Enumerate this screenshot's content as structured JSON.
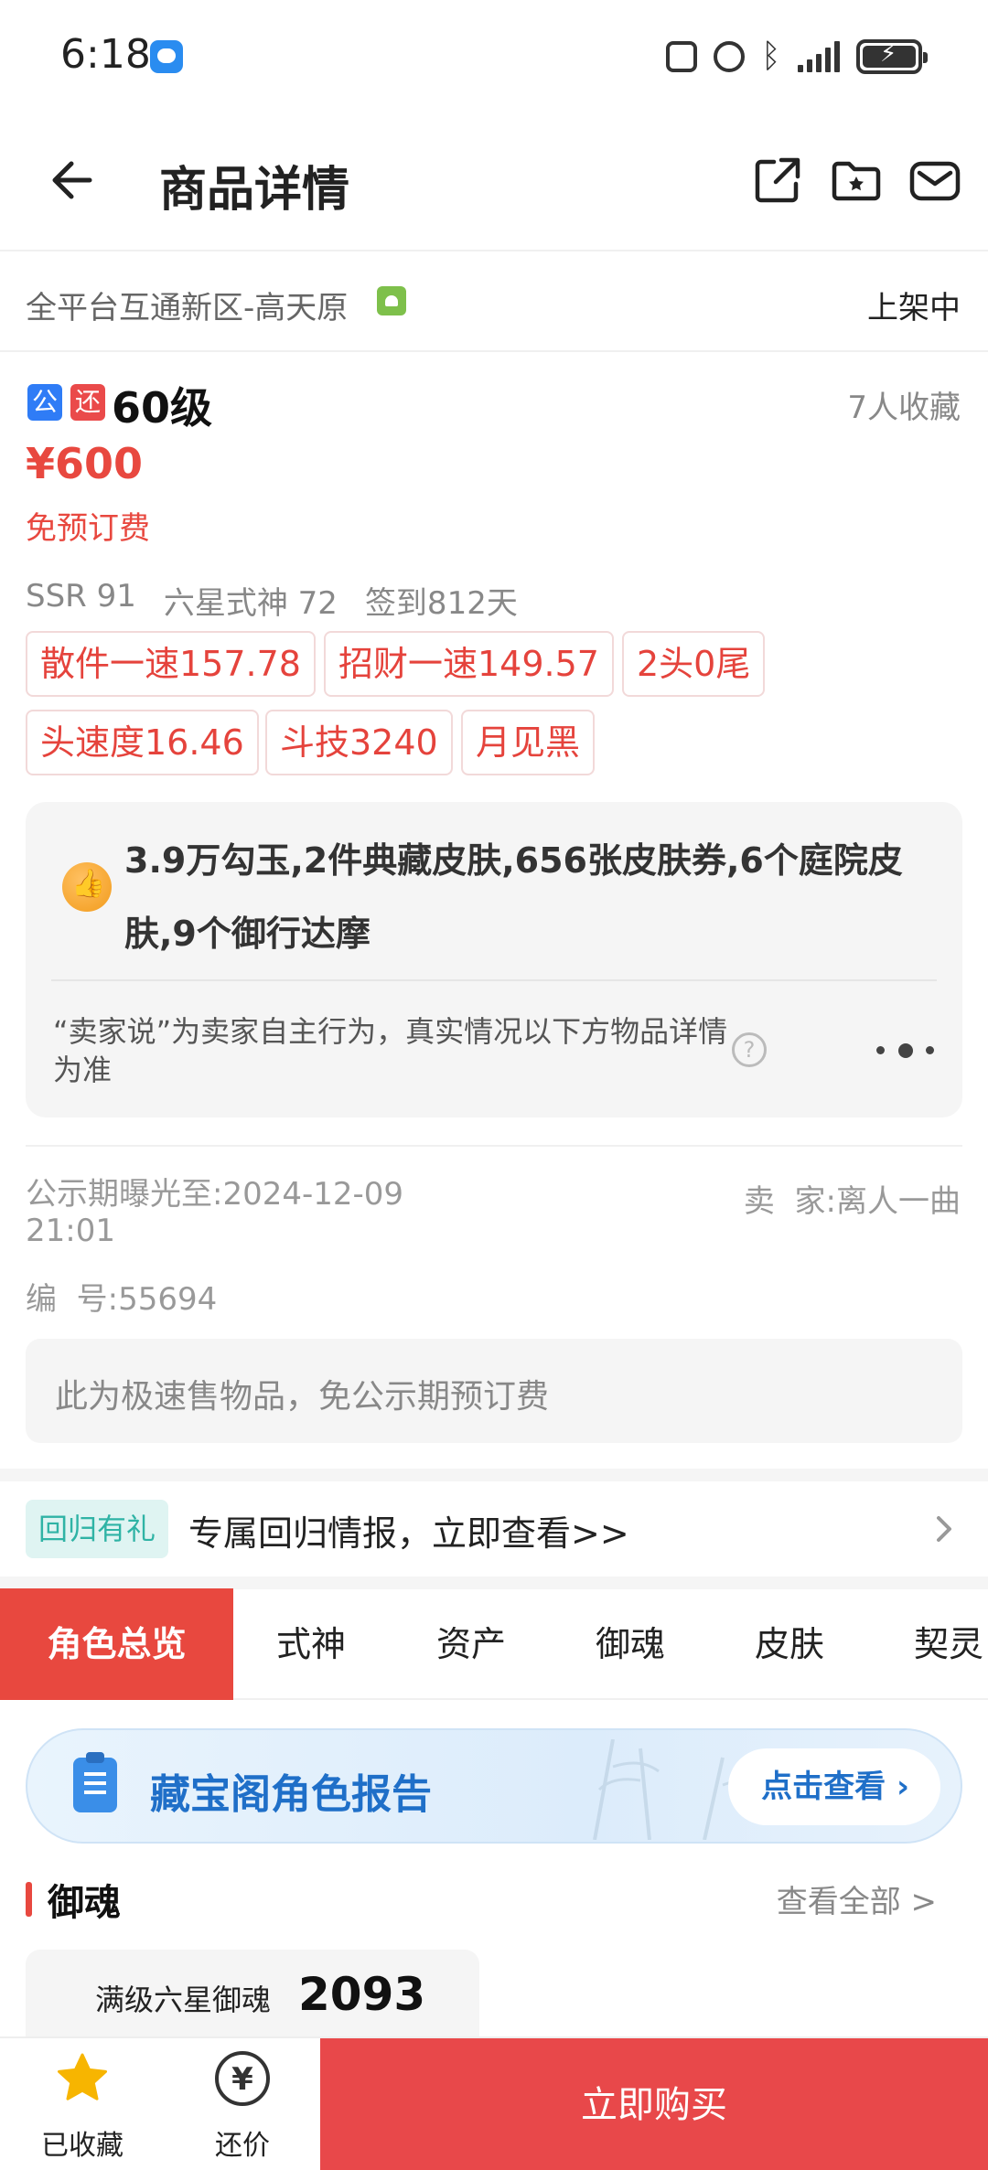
{
  "status_bar": {
    "time": "6:18",
    "icons": [
      "nfc-icon",
      "alarm-icon",
      "bluetooth-icon",
      "signal-icon",
      "battery-icon"
    ]
  },
  "nav": {
    "title": "商品详情",
    "icons": [
      "back-arrow-icon",
      "share-icon",
      "favorite-folder-icon",
      "message-icon"
    ]
  },
  "region": {
    "server": "全平台互通新区-高天原",
    "status": "上架中"
  },
  "item": {
    "tag_public": "公",
    "tag_bargain": "还",
    "title": "60级",
    "favorites": "7人收藏",
    "price": "¥600",
    "fee_note": "免预订费"
  },
  "stats": {
    "ssr": "SSR 91",
    "six_star": "六星式神 72",
    "checkin": "签到812天"
  },
  "chips": [
    "散件一速157.78",
    "招财一速149.57",
    "2头0尾",
    "头速度16.46",
    "斗技3240",
    "月见黑"
  ],
  "seller_says": {
    "highlight": "3.9万勾玉,2件典藏皮肤,656张皮肤券,6个庭院皮肤,9个御行达摩",
    "disclaimer": "“卖家说”为卖家自主行为，真实情况以下方物品详情为准",
    "help_glyph": "?"
  },
  "meta": {
    "exposure_label": "公示期曝光至:",
    "exposure_date": "2024-12-09",
    "exposure_time": "21:01",
    "seller_label": "卖  家:",
    "seller_name": "离人一曲",
    "serial_label": "编  号:",
    "serial_value": "55694"
  },
  "fast_sale": "此为极速售物品，免公示期预订费",
  "return_promo": {
    "badge": "回归有礼",
    "text": "专属回归情报，立即查看>>"
  },
  "tabs": [
    "角色总览",
    "式神",
    "资产",
    "御魂",
    "皮肤",
    "契灵"
  ],
  "active_tab": 0,
  "report": {
    "title": "藏宝阁角色报告",
    "button": "点击查看 ›"
  },
  "soul_section": {
    "title": "御魂",
    "more": "查看全部 >",
    "label": "满级六星御魂",
    "value": "2093"
  },
  "bottom_bar": {
    "favorite_label": "已收藏",
    "bargain_label": "还价",
    "bargain_glyph": "¥",
    "buy_label": "立即购买"
  },
  "colors": {
    "accent_red": "#e8483f",
    "favorite_star": "#f7b500",
    "report_blue": "#1f6fc8"
  }
}
